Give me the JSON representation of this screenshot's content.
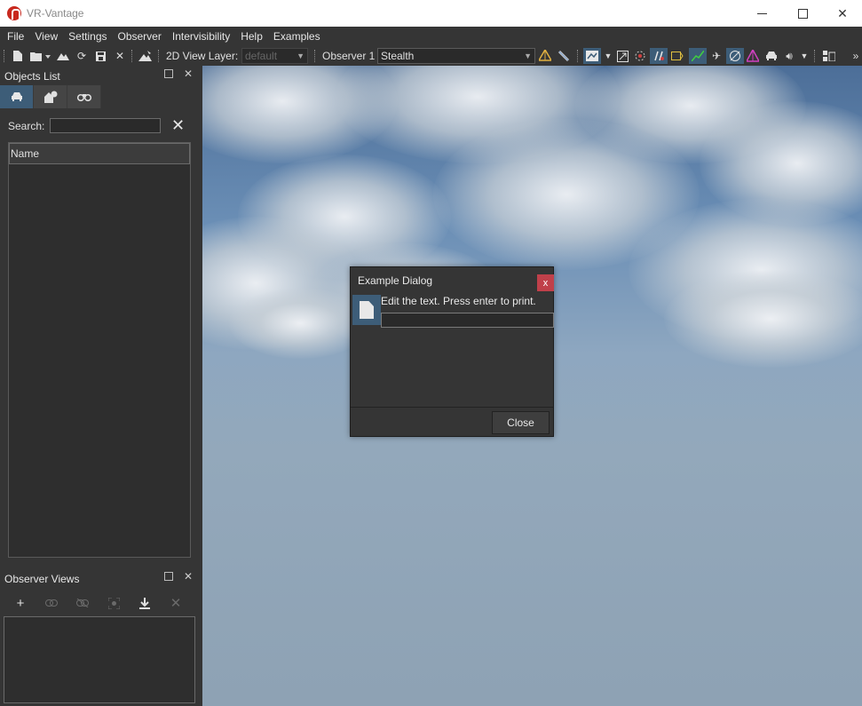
{
  "window": {
    "title": "VR-Vantage"
  },
  "menu": [
    "File",
    "View",
    "Settings",
    "Observer",
    "Intervisibility",
    "Help",
    "Examples"
  ],
  "toolbar": {
    "view_layer_label": "2D View Layer:",
    "view_layer_value": "default",
    "observer_label": "Observer 1",
    "observer_value": "Stealth",
    "overflow_glyph": "»"
  },
  "objects_panel": {
    "title": "Objects List",
    "tabs": [
      "vehicle-icon",
      "terrain-object-icon",
      "binoculars-icon"
    ],
    "search_label": "Search:",
    "search_value": "",
    "clear_glyph": "✕",
    "column_header": "Name"
  },
  "observer_views_panel": {
    "title": "Observer Views",
    "tools": [
      "add-icon",
      "link-icon",
      "unlink-icon",
      "capture-icon",
      "download-icon",
      "delete-icon"
    ]
  },
  "dialog": {
    "title": "Example Dialog",
    "close_x": "x",
    "message": "Edit the text. Press enter to print.",
    "input_value": "",
    "close_button": "Close"
  },
  "colors": {
    "panel_bg": "#353535",
    "highlight": "#3d5d78",
    "dialog_close_x": "#c0404a"
  }
}
